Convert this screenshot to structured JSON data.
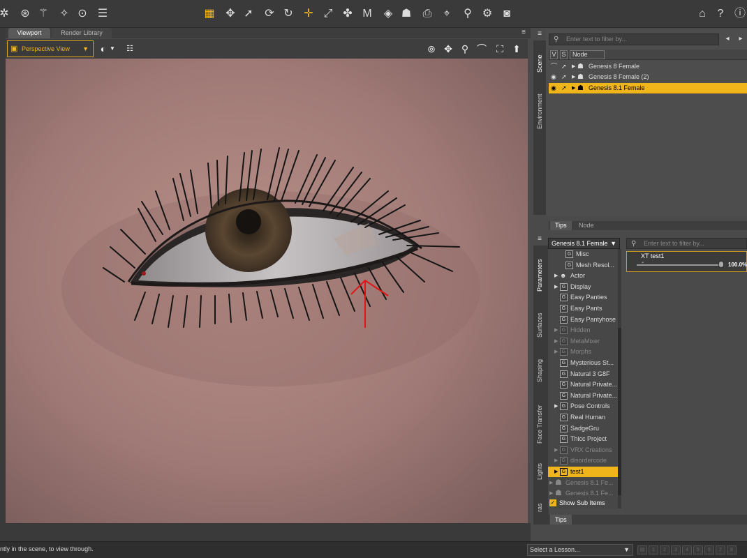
{
  "viewport_tabs": [
    "Viewport",
    "Render Library"
  ],
  "viewport_header": {
    "camera": "Perspective View"
  },
  "scene": {
    "filter_placeholder": "Enter text to filter by...",
    "columns": {
      "visible": "V",
      "selectable": "S",
      "node": "Node"
    },
    "side_tabs": [
      "Scene",
      "Environment"
    ],
    "nodes": [
      {
        "label": "Genesis 8 Female",
        "selected": false
      },
      {
        "label": "Genesis 8 Female (2)",
        "selected": false
      },
      {
        "label": "Genesis 8.1 Female",
        "selected": true
      }
    ]
  },
  "mid_tabs": [
    "Tips",
    "Node"
  ],
  "parameters": {
    "side_tabs": [
      "Parameters",
      "Surfaces",
      "Shaping",
      "Face Transfer",
      "Lights",
      "ras"
    ],
    "node_select": "Genesis 8.1 Female",
    "filter_placeholder": "Enter text to filter by...",
    "tree": [
      {
        "label": "Misc",
        "indent": 2,
        "icon": "G",
        "expand": false,
        "dim": false
      },
      {
        "label": "Mesh Resol...",
        "indent": 2,
        "icon": "G",
        "expand": false,
        "dim": false
      },
      {
        "label": "Actor",
        "indent": 1,
        "icon": "person",
        "expand": true,
        "dim": false
      },
      {
        "label": "Display",
        "indent": 1,
        "icon": "G",
        "expand": true,
        "dim": false
      },
      {
        "label": "Easy Panties",
        "indent": 1,
        "icon": "G",
        "expand": false,
        "dim": false
      },
      {
        "label": "Easy Pants",
        "indent": 1,
        "icon": "G",
        "expand": false,
        "dim": false
      },
      {
        "label": "Easy Pantyhose",
        "indent": 1,
        "icon": "G",
        "expand": false,
        "dim": false
      },
      {
        "label": "Hidden",
        "indent": 1,
        "icon": "G",
        "expand": true,
        "dim": true
      },
      {
        "label": "MetaMixer",
        "indent": 1,
        "icon": "G",
        "expand": true,
        "dim": true
      },
      {
        "label": "Morphs",
        "indent": 1,
        "icon": "G",
        "expand": true,
        "dim": true
      },
      {
        "label": "Mysterious St...",
        "indent": 1,
        "icon": "G",
        "expand": false,
        "dim": false
      },
      {
        "label": "Natural 3 G8F",
        "indent": 1,
        "icon": "G",
        "expand": false,
        "dim": false
      },
      {
        "label": "Natural Private...",
        "indent": 1,
        "icon": "G",
        "expand": false,
        "dim": false
      },
      {
        "label": "Natural Private...",
        "indent": 1,
        "icon": "G",
        "expand": false,
        "dim": false
      },
      {
        "label": "Pose Controls",
        "indent": 1,
        "icon": "G",
        "expand": true,
        "dim": false
      },
      {
        "label": "Real Human",
        "indent": 1,
        "icon": "G",
        "expand": false,
        "dim": false
      },
      {
        "label": "SadgeGru",
        "indent": 1,
        "icon": "G",
        "expand": false,
        "dim": false
      },
      {
        "label": "Thicc Project",
        "indent": 1,
        "icon": "G",
        "expand": false,
        "dim": false
      },
      {
        "label": "VRX Creations",
        "indent": 1,
        "icon": "G",
        "expand": true,
        "dim": true
      },
      {
        "label": "disordercode",
        "indent": 1,
        "icon": "G",
        "expand": true,
        "dim": true
      },
      {
        "label": "test1",
        "indent": 1,
        "icon": "G",
        "expand": true,
        "dim": false,
        "selected": true
      },
      {
        "label": "Genesis 8.1 Fe...",
        "indent": 0,
        "icon": "figure",
        "expand": true,
        "dim": true
      },
      {
        "label": "Genesis 8.1 Fe...",
        "indent": 0,
        "icon": "figure",
        "expand": true,
        "dim": true
      }
    ],
    "show_sub_items": "Show Sub Items",
    "property": {
      "name": "XT test1",
      "value": "100.0%",
      "fraction": 1.0
    }
  },
  "bottom_tabs": [
    "Tips"
  ],
  "status": {
    "message": "ntly in the scene, to view through.",
    "lesson_select": "Select a Lesson...",
    "page_boxes": [
      "1",
      "2",
      "3",
      "4",
      "5",
      "6",
      "7",
      "8",
      "9"
    ]
  },
  "colors": {
    "accent": "#f1b51c",
    "annotation_arrow": "#e01515"
  }
}
